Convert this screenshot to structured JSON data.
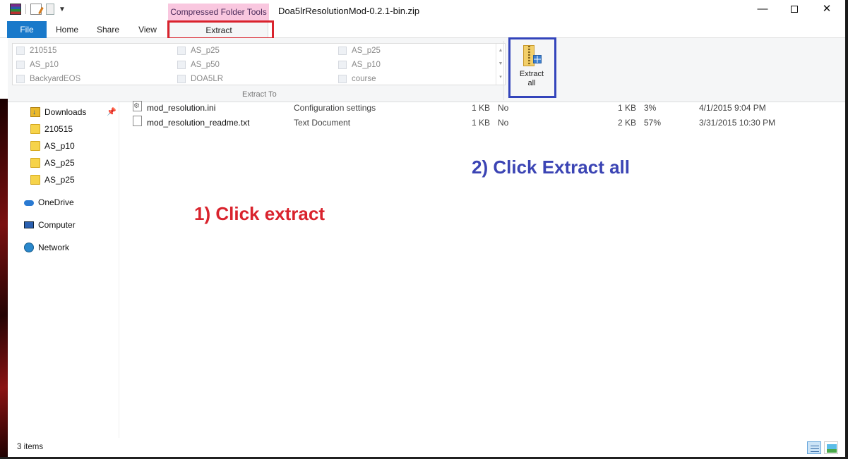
{
  "window": {
    "title": "Doa5lrResolutionMod-0.2.1-bin.zip",
    "contextual_tab_group": "Compressed Folder Tools",
    "minimize_glyph": "—",
    "close_glyph": "✕"
  },
  "ribbon_tabs": {
    "file": "File",
    "home": "Home",
    "share": "Share",
    "view": "View",
    "extract": "Extract"
  },
  "extract_to": {
    "group_label": "Extract To",
    "destinations": [
      "210515",
      "AS_p25",
      "AS_p25",
      "AS_p10",
      "AS_p50",
      "AS_p10",
      "BackyardEOS",
      "DOA5LR",
      "course"
    ]
  },
  "extract_all": {
    "line1": "Extract",
    "line2": "all"
  },
  "nav": {
    "items": [
      {
        "label": "Downloads"
      },
      {
        "label": "210515"
      },
      {
        "label": "AS_p10"
      },
      {
        "label": "AS_p25"
      },
      {
        "label": "AS_p25"
      },
      {
        "label": "OneDrive"
      },
      {
        "label": "Computer"
      },
      {
        "label": "Network"
      }
    ]
  },
  "files": [
    {
      "name": "mod_resolution.ini",
      "type": "Configuration settings",
      "packed": "1 KB",
      "encrypted": "No",
      "size": "1 KB",
      "ratio": "3%",
      "date": "4/1/2015 9:04 PM"
    },
    {
      "name": "mod_resolution_readme.txt",
      "type": "Text Document",
      "packed": "1 KB",
      "encrypted": "No",
      "size": "2 KB",
      "ratio": "57%",
      "date": "3/31/2015 10:30 PM"
    }
  ],
  "annotations": {
    "step1": "1) Click extract",
    "step2": "2) Click Extract all",
    "step1_color": "#d9232d",
    "step2_color": "#3b44b4"
  },
  "status": {
    "item_count": "3 items"
  },
  "icons": {
    "app": "winrar-icon",
    "help": "help-icon",
    "extract_all": "zip-folder-extract-icon"
  }
}
